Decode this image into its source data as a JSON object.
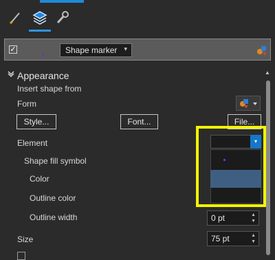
{
  "tabs": [
    {
      "name": "brush-icon"
    },
    {
      "name": "layers-icon",
      "active": true
    },
    {
      "name": "wrench-icon"
    }
  ],
  "symbol_row": {
    "checked": true,
    "check_glyph": "✓",
    "dropdown_value": "Shape marker",
    "caret": "▾"
  },
  "appearance": {
    "section_title": "Appearance",
    "chevron": "⌄",
    "insert_shape_from": "Insert shape from",
    "form_label": "Form",
    "buttons": {
      "style": "Style...",
      "font": "Font...",
      "file": "File..."
    },
    "element_label": "Element",
    "element_caret": "▾",
    "shape_fill_symbol": "Shape fill symbol",
    "color_label": "Color",
    "outline_color_label": "Outline color",
    "outline_width_label": "Outline width",
    "outline_width_value": "0 pt",
    "size_label": "Size",
    "size_value": "75 pt",
    "spin_up": "▲",
    "spin_down": "▼"
  },
  "scroll": {
    "up_glyph": "▲"
  },
  "colors": {
    "accent_blue": "#1f8ad8",
    "highlight_yellow": "#f5f500",
    "selected_item": "#3f5f82",
    "marker_purple": "#7a2cc8"
  }
}
